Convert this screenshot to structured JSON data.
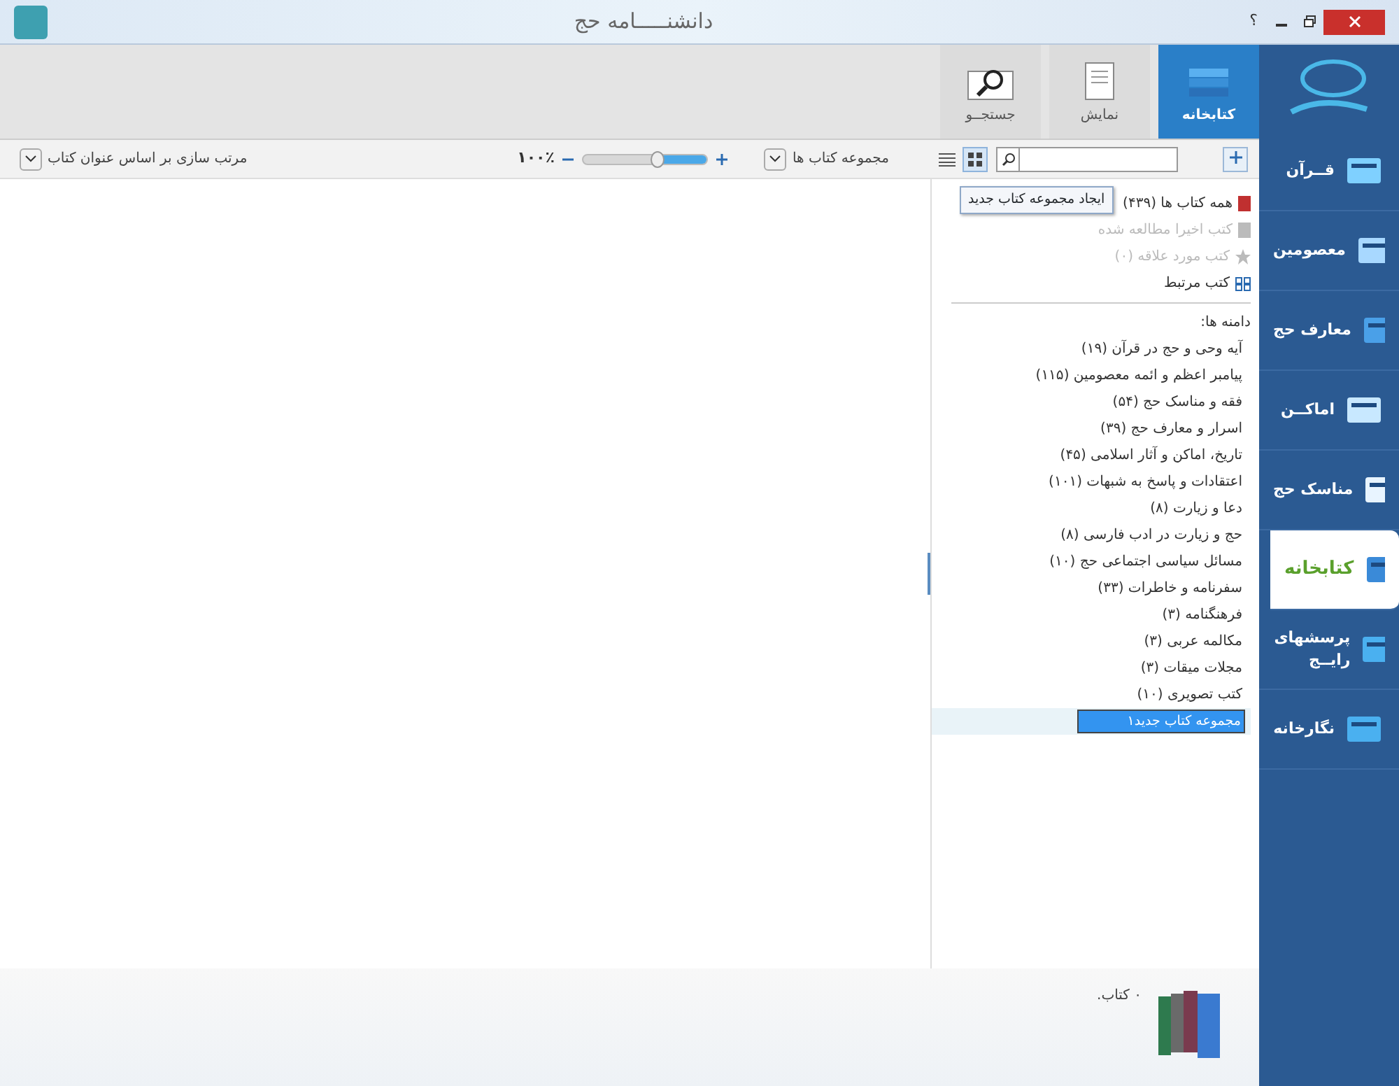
{
  "window": {
    "title": "دانشنـــــامه حج",
    "help": "؟"
  },
  "sidebar": {
    "items": [
      {
        "label": "قــرآن",
        "selected": false
      },
      {
        "label": "معصومین",
        "selected": false
      },
      {
        "label": "معارف حج",
        "selected": false
      },
      {
        "label": "اماکــن",
        "selected": false
      },
      {
        "label": "مناسک حج",
        "selected": false
      },
      {
        "label": "کتابخانه",
        "selected": true
      },
      {
        "label": "پرسشهای رایــج",
        "selected": false
      },
      {
        "label": "نگارخانه",
        "selected": false
      }
    ]
  },
  "ribbon": {
    "tabs": [
      {
        "label": "کتابخانه",
        "selected": true
      },
      {
        "label": "نمایش",
        "selected": false
      },
      {
        "label": "جستجــو",
        "selected": false
      }
    ]
  },
  "toolbar": {
    "view_modes": [
      {
        "kind": "grid",
        "selected": true
      },
      {
        "kind": "list",
        "selected": false
      }
    ],
    "collection": "مجموعه کتاب ها",
    "zoom": {
      "level": 0.4,
      "reading": "۱۰۰٪"
    },
    "sort": "مرتب سازی بر اساس عنوان کتاب"
  },
  "tree": {
    "items": [
      {
        "kind": "all",
        "label": "همه کتاب ها (۴۳۹)",
        "disabled": false
      },
      {
        "kind": "recent",
        "label": "کتب اخیرا مطالعه شده",
        "disabled": true
      },
      {
        "kind": "favorite",
        "label": "کتب مورد علاقه (۰)",
        "disabled": true
      },
      {
        "kind": "related",
        "label": "کتب مرتبط",
        "disabled": false
      }
    ],
    "tooltip": "ایجاد مجموعه کتاب جدید",
    "domains_heading": "دامنه ها:",
    "domains": [
      "آیه وحی و حج در قرآن (۱۹)",
      "پیامبر اعظم و ائمه معصومین (۱۱۵)",
      "فقه و مناسک حج (۵۴)",
      "اسرار و معارف حج (۳۹)",
      "تاریخ، اماکن و آثار اسلامی (۴۵)",
      "اعتقادات و پاسخ به شبهات (۱۰۱)",
      "دعا و زیارت (۸)",
      "حج و زیارت در ادب فارسی (۸)",
      "مسائل سیاسی اجتماعی حج (۱۰)",
      "سفرنامه و خاطرات (۳۳)",
      "فرهنگنامه (۳)",
      "مکالمه عربی (۳)",
      "مجلات میقات (۳)",
      "کتب تصویری (۱۰)"
    ],
    "new_collection": {
      "value": "مجموعه کتاب جدید۱"
    }
  },
  "status": {
    "count": "۰ کتاب."
  }
}
